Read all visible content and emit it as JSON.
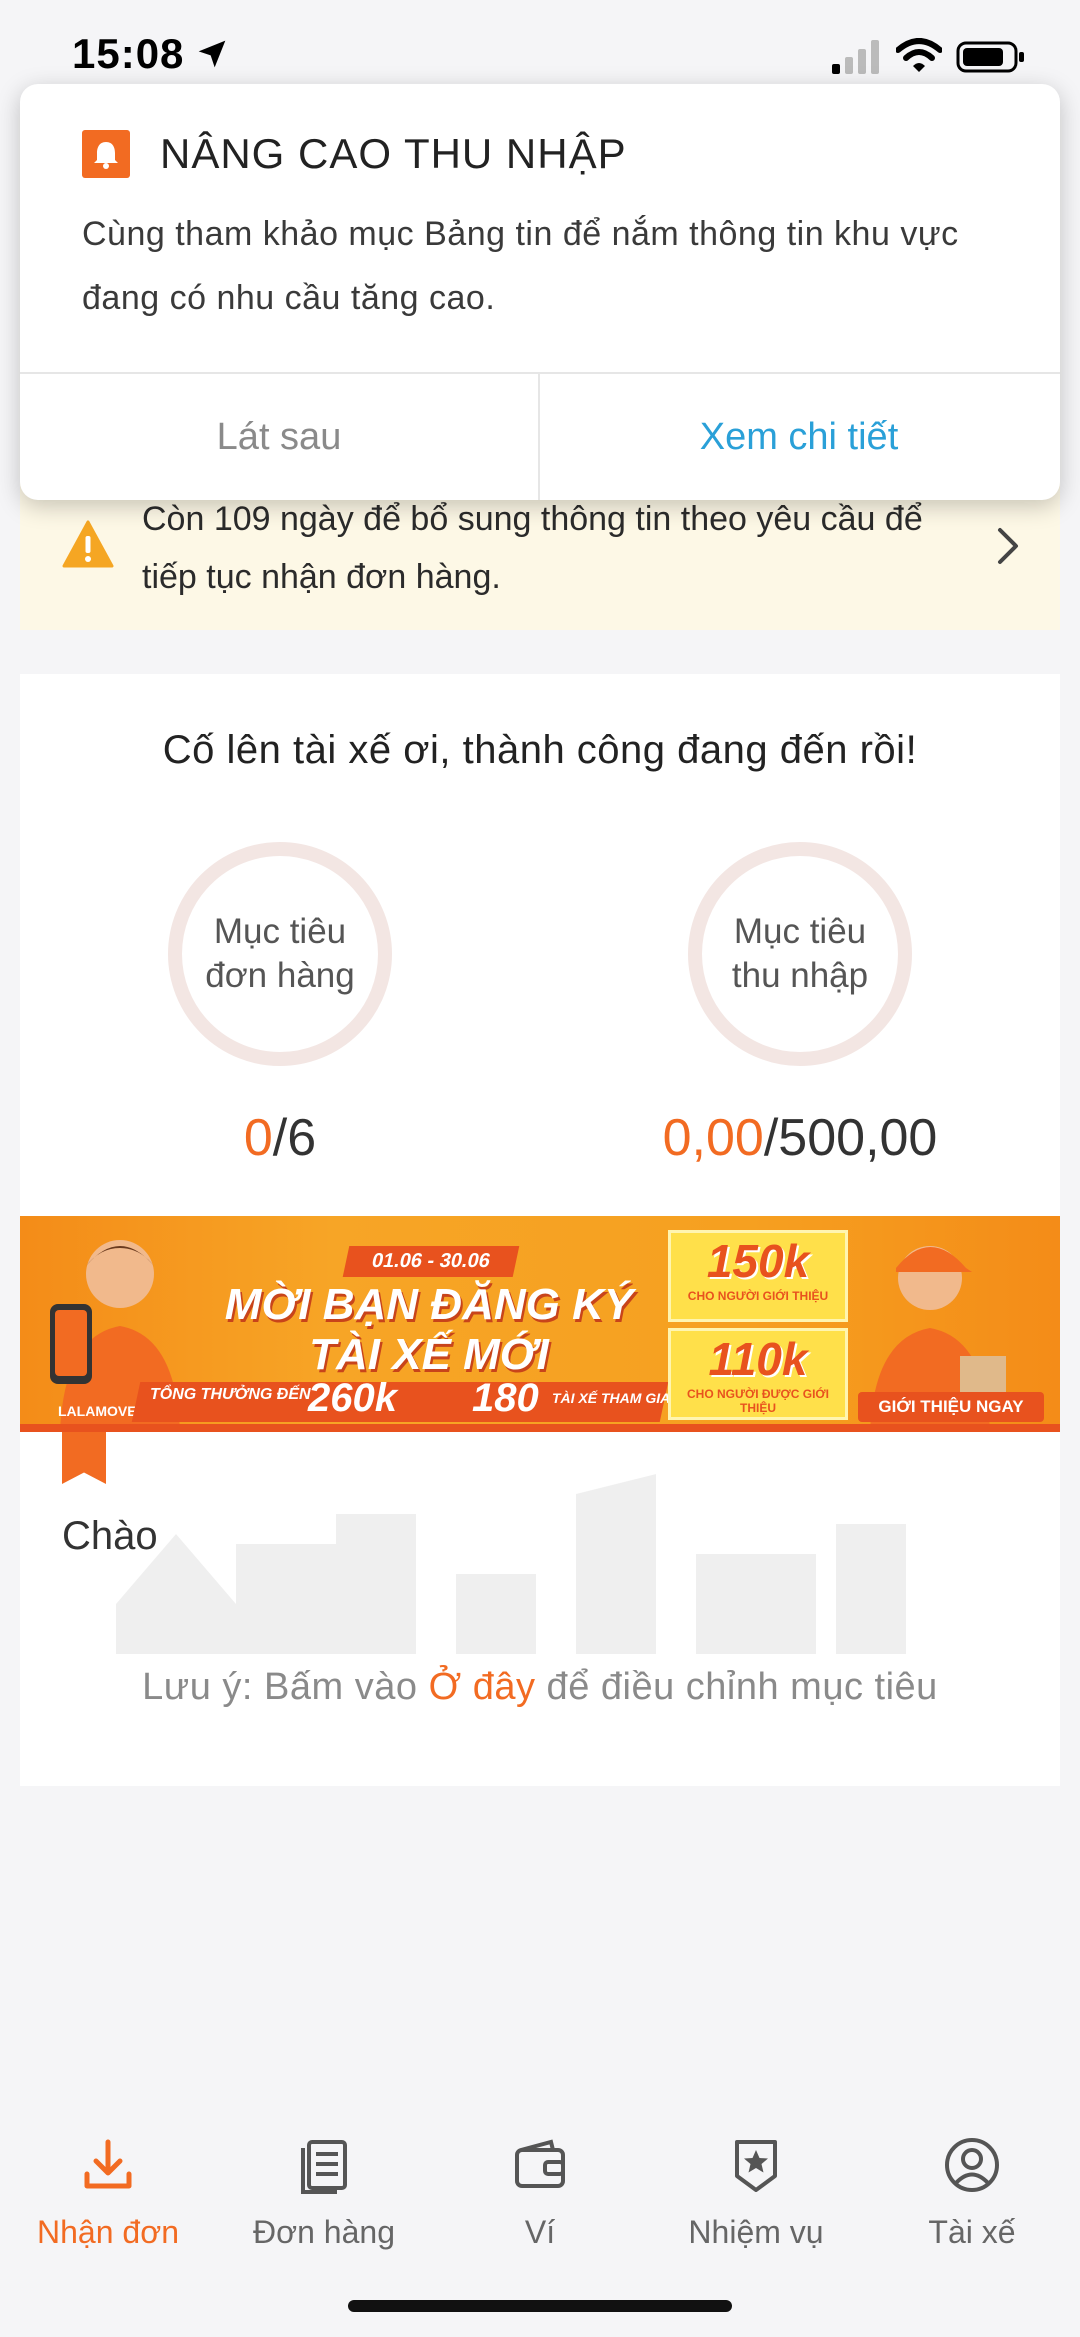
{
  "status_bar": {
    "time": "15:08"
  },
  "notification": {
    "title": "NÂNG CAO THU NHẬP",
    "body": "Cùng tham khảo mục Bảng tin để nắm thông tin khu vực đang có nhu cầu tăng cao.",
    "later_label": "Lát sau",
    "detail_label": "Xem chi tiết"
  },
  "warning": {
    "text": "Còn 109 ngày để bổ sung thông tin theo yêu cầu để tiếp tục nhận đơn hàng."
  },
  "goals": {
    "slogan": "Cố lên tài xế ơi, thành công đang đến rồi!",
    "order_goal_label": "Mục tiêu đơn hàng",
    "income_goal_label": "Mục tiêu thu nhập",
    "order_current": "0",
    "order_target": "/6",
    "income_current": "0,00",
    "income_target": "/500,00"
  },
  "banner": {
    "date": "01.06 - 30.06",
    "title_line1": "MỜI BẠN ĐĂNG KÝ",
    "title_line2": "TÀI XẾ MỚI",
    "bonus_prefix": "TỔNG THƯỞNG ĐẾN",
    "bonus_amount": "260k",
    "drivers_count": "180",
    "drivers_suffix": "TÀI XẾ THAM GIA",
    "referrer_amount": "150k",
    "referrer_label": "CHO NGƯỜI GIỚI THIỆU",
    "referee_amount": "110k",
    "referee_label": "CHO NGƯỜI ĐƯỢC GIỚI THIỆU",
    "cta": "GIỚI THIỆU NGAY",
    "brand": "LALAMOVE"
  },
  "greeting": "Chào",
  "note": {
    "prefix": "Lưu ý: Bấm vào ",
    "link": "Ở đây",
    "suffix": " để điều chỉnh mục tiêu"
  },
  "tabs": [
    {
      "label": "Nhận đơn",
      "icon": "download-icon",
      "active": true
    },
    {
      "label": "Đơn hàng",
      "icon": "document-list-icon"
    },
    {
      "label": "Ví",
      "icon": "wallet-icon"
    },
    {
      "label": "Nhiệm vụ",
      "icon": "star-badge-icon"
    },
    {
      "label": "Tài xế",
      "icon": "user-circle-icon"
    }
  ],
  "colors": {
    "accent": "#f26b22",
    "link_blue": "#2aa0d8",
    "warning_bg": "#fdf8e6",
    "ring": "#f3e6e3"
  }
}
